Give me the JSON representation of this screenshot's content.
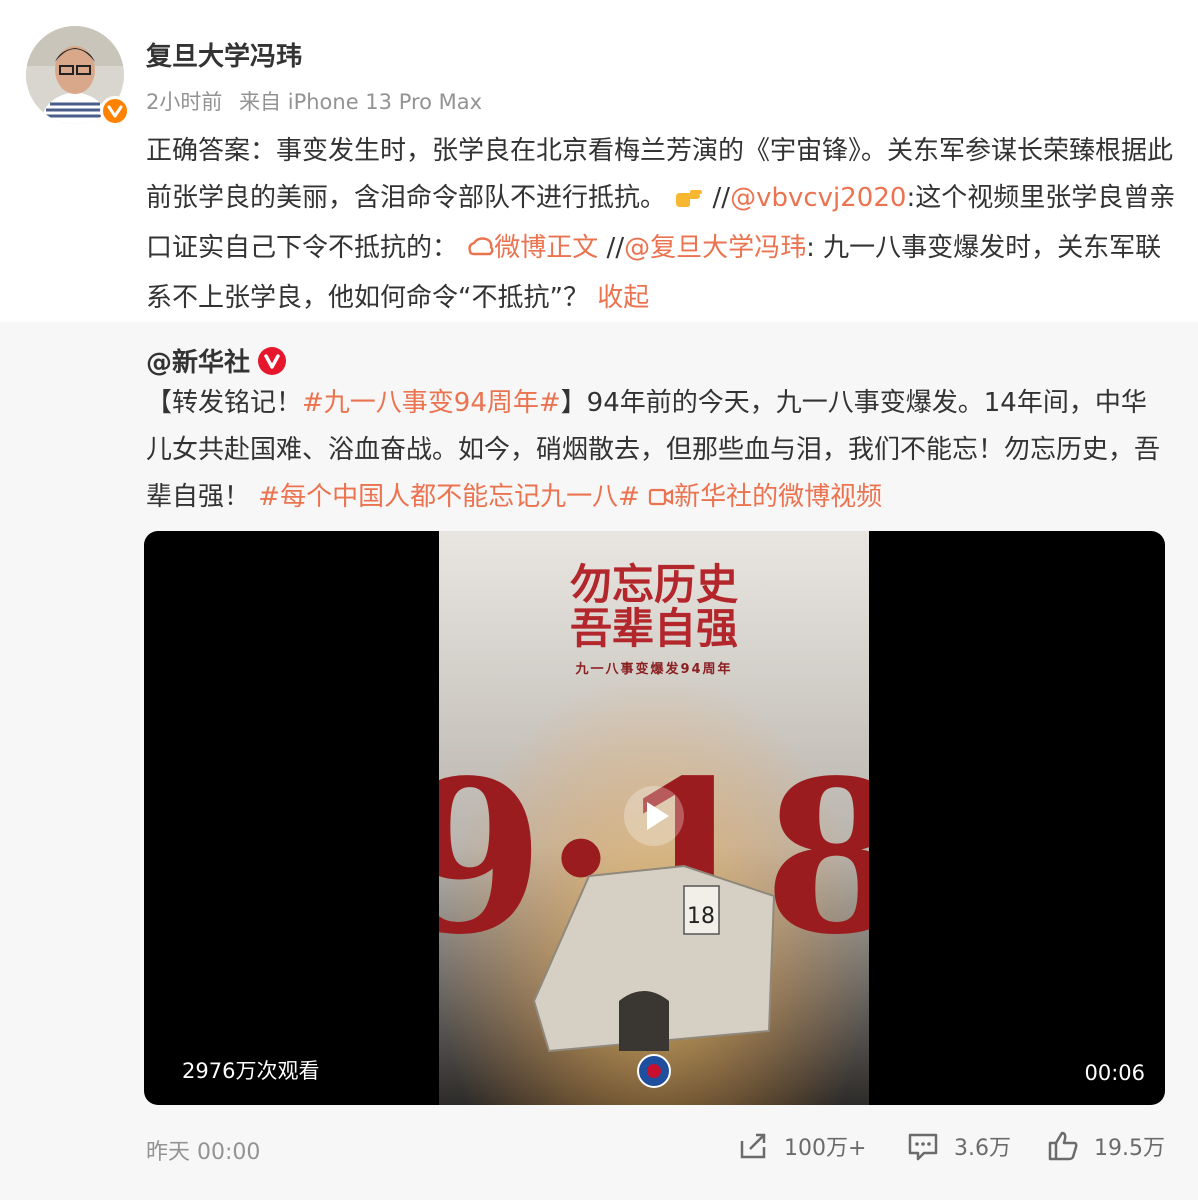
{
  "author": {
    "name": "复旦大学冯玮",
    "time": "2小时前",
    "source": "来自 iPhone 13 Pro Max"
  },
  "post": {
    "text1": "正确答案：事变发生时，张学良在北京看梅兰芳演的《宇宙锋》。关东军参谋长荣臻根据此前张学良的美丽，含泪命令部队不进行抵抗。",
    "sep1": "//",
    "mention1": "@vbvcvj2020",
    "text2": ":这个视频里张学良曾亲口证实自己下令不抵抗的：",
    "weibo_link": "微博正文",
    "sep2": " //",
    "mention2": "@复旦大学冯玮",
    "text3": ": 九一八事变爆发时，关东军联系不上张学良，他如何命令“不抵抗”？ ",
    "collapse": "收起"
  },
  "quoted": {
    "author": "@新华社",
    "text1": "【转发铭记！",
    "hashtag1": "#九一八事变94周年#",
    "text2": "】94年前的今天，九一八事变爆发。14年间，中华儿女共赴国难、浴血奋战。如今，硝烟散去，但那些血与泪，我们不能忘！勿忘历史，吾辈自强！",
    "hashtag2": "#每个中国人都不能忘记九一八#",
    "video_link": "新华社的微博视频",
    "video": {
      "poster_title_1": "勿忘历史",
      "poster_title_2": "吾辈自强",
      "poster_subtitle": "九一八事变爆发94周年",
      "poster_big": "9·18",
      "poster_calendar_day": "18",
      "views": "2976万次观看",
      "duration": "00:06"
    },
    "footer": {
      "time": "昨天 00:00",
      "shares": "100万+",
      "comments": "3.6万",
      "likes": "19.5万"
    }
  },
  "icons": {
    "verified_badge": "orange-v-badge",
    "quoted_verified_badge": "red-v-badge",
    "hand_pointing": "pointing-hand-icon",
    "weibo_link_icon": "weibo-link-icon",
    "video_link_icon": "video-icon",
    "share": "share-icon",
    "comment": "comment-icon",
    "like": "thumbs-up-icon",
    "play": "play-icon"
  },
  "colors": {
    "accent": "#eb7350",
    "verified_orange": "#ff8200",
    "verified_red": "#e6162d",
    "quote_bg": "#f7f7f7"
  }
}
